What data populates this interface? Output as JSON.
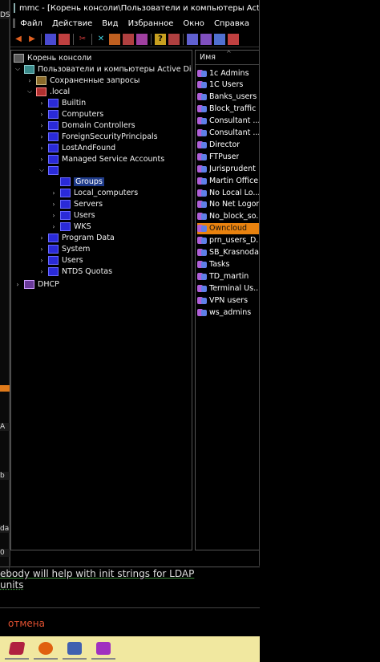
{
  "window": {
    "title": "mmc - [Корень консоли\\Пользователи и компьютеры Active Directo"
  },
  "left_strip": {
    "tags": [
      "DS",
      "A",
      "b",
      "da",
      "0"
    ]
  },
  "menu": [
    "Файл",
    "Действие",
    "Вид",
    "Избранное",
    "Окно",
    "Справка"
  ],
  "toolbar": {
    "icons": [
      "back-arrow-icon",
      "forward-arrow-icon",
      "up-folder-icon",
      "show-tree-icon",
      "cut-icon",
      "delete-icon",
      "properties-icon",
      "refresh-icon",
      "export-icon",
      "help-icon",
      "console-icon",
      "users-icon",
      "add-user-icon",
      "add-group-icon",
      "filter-icon"
    ]
  },
  "tree": {
    "root": "Корень консоли",
    "ad": "Пользователи и компьютеры Active Director",
    "saved_queries": "Сохраненные запросы",
    "domain": ".local",
    "items": [
      "Builtin",
      "Computers",
      "Domain Controllers",
      "ForeignSecurityPrincipals",
      "LostAndFound",
      "Managed Service Accounts"
    ],
    "ou_children": [
      "Groups",
      "Local_computers",
      "Servers",
      "Users",
      "WKS"
    ],
    "items_after": [
      "Program Data",
      "System",
      "Users",
      "NTDS Quotas"
    ],
    "dhcp": "DHCP"
  },
  "list": {
    "header": "Имя",
    "rows": [
      "1c Admins",
      "1C Users",
      "Banks_users",
      "Block_traffic",
      "Consultant ...",
      "Consultant ...",
      "Director",
      "FTPuser",
      "Jurisprudent",
      "Martin Office",
      "No Local Lo...",
      "No Net Logon",
      "No_block_so...",
      "Owncloud",
      "prn_users_D...",
      "SB_Krasnodar",
      "Tasks",
      "TD_martin",
      "Terminal Us...",
      "VPN users",
      "ws_admins"
    ],
    "highlighted_index": 13
  },
  "background": {
    "line1": "ebody will help with init strings for LDAP",
    "line2": "units",
    "cancel": "отмена"
  },
  "colors": {
    "highlight": "#e8820f",
    "taskbar": "#f1e8a0",
    "cancel": "#e05030"
  }
}
